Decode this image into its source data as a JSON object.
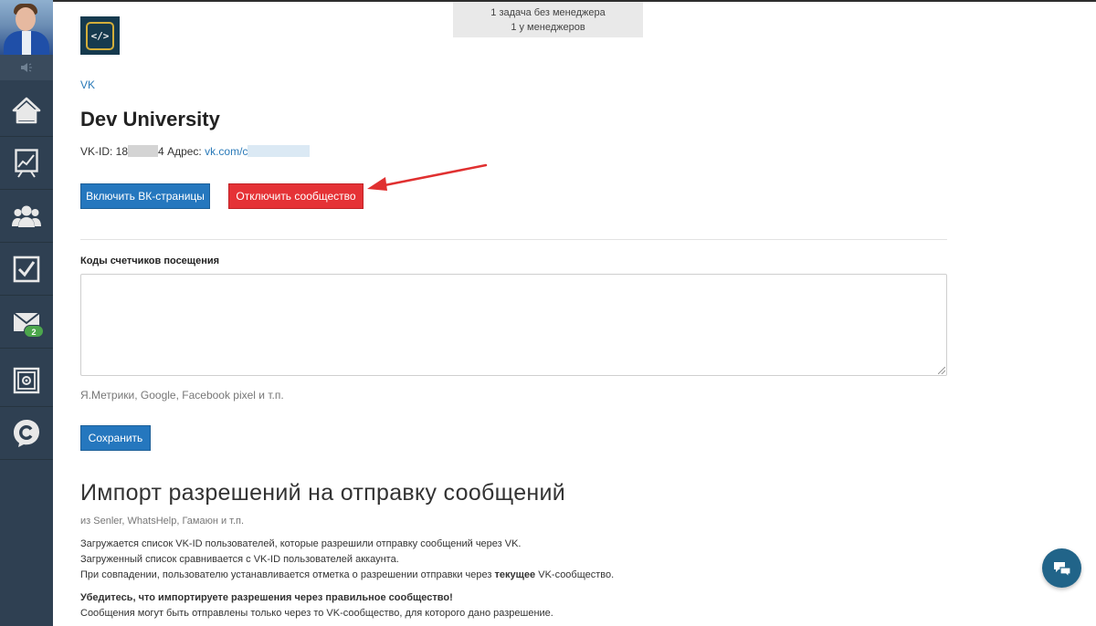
{
  "sidebar": {
    "nav_items": [
      "home",
      "stats",
      "users",
      "tasks",
      "messages",
      "safe",
      "logo-c"
    ],
    "messages_badge": "2"
  },
  "notice": {
    "line1": "1 задача без менеджера",
    "line2": "1 у менеджеров"
  },
  "logo_text": "</>",
  "breadcrumb": "VK",
  "page_title": "Dev University",
  "meta": {
    "vkid_label": "VK-ID: 18",
    "vkid_suffix": "4",
    "address_label": "Адрес:",
    "address_link": "vk.com/c"
  },
  "buttons": {
    "enable_vk_pages": "Включить ВК-страницы",
    "disable_community": "Отключить сообщество",
    "save": "Сохранить"
  },
  "counters": {
    "label": "Коды счетчиков посещения",
    "hint": "Я.Метрики, Google, Facebook pixel и т.п.",
    "value": ""
  },
  "import": {
    "title": "Импорт разрешений на отправку сообщений",
    "subtitle": "из Senler, WhatsHelp, Гамаюн и т.п.",
    "line1": "Загружается список VK-ID пользователей, которые разрешили отправку сообщений через VK.",
    "line2": "Загруженный список сравнивается с VK-ID пользователей аккаунта.",
    "line3_prefix": "При совпадении, пользователю устанавливается отметка о разрешении отправки через ",
    "line3_bold": "текущее",
    "line3_suffix": " VK-сообщество.",
    "warning": "Убедитесь, что импортируете разрешения через правильное сообщество!",
    "line4": "Сообщения могут быть отправлены только через то VK-сообщество, для которого дано разрешение."
  },
  "colors": {
    "sidebar": "#2f4052",
    "primary_blue": "#2577be",
    "danger_red": "#e53236",
    "link": "#2a7ab8",
    "badge_green": "#4ca64c",
    "chat_fab": "#216489"
  }
}
